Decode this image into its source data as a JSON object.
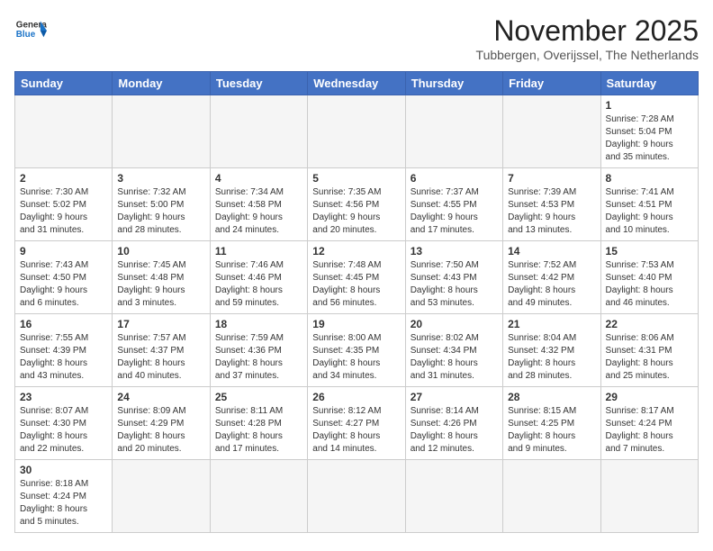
{
  "header": {
    "logo_general": "General",
    "logo_blue": "Blue",
    "month_year": "November 2025",
    "location": "Tubbergen, Overijssel, The Netherlands"
  },
  "weekdays": [
    "Sunday",
    "Monday",
    "Tuesday",
    "Wednesday",
    "Thursday",
    "Friday",
    "Saturday"
  ],
  "weeks": [
    [
      {
        "day": "",
        "info": ""
      },
      {
        "day": "",
        "info": ""
      },
      {
        "day": "",
        "info": ""
      },
      {
        "day": "",
        "info": ""
      },
      {
        "day": "",
        "info": ""
      },
      {
        "day": "",
        "info": ""
      },
      {
        "day": "1",
        "info": "Sunrise: 7:28 AM\nSunset: 5:04 PM\nDaylight: 9 hours\nand 35 minutes."
      }
    ],
    [
      {
        "day": "2",
        "info": "Sunrise: 7:30 AM\nSunset: 5:02 PM\nDaylight: 9 hours\nand 31 minutes."
      },
      {
        "day": "3",
        "info": "Sunrise: 7:32 AM\nSunset: 5:00 PM\nDaylight: 9 hours\nand 28 minutes."
      },
      {
        "day": "4",
        "info": "Sunrise: 7:34 AM\nSunset: 4:58 PM\nDaylight: 9 hours\nand 24 minutes."
      },
      {
        "day": "5",
        "info": "Sunrise: 7:35 AM\nSunset: 4:56 PM\nDaylight: 9 hours\nand 20 minutes."
      },
      {
        "day": "6",
        "info": "Sunrise: 7:37 AM\nSunset: 4:55 PM\nDaylight: 9 hours\nand 17 minutes."
      },
      {
        "day": "7",
        "info": "Sunrise: 7:39 AM\nSunset: 4:53 PM\nDaylight: 9 hours\nand 13 minutes."
      },
      {
        "day": "8",
        "info": "Sunrise: 7:41 AM\nSunset: 4:51 PM\nDaylight: 9 hours\nand 10 minutes."
      }
    ],
    [
      {
        "day": "9",
        "info": "Sunrise: 7:43 AM\nSunset: 4:50 PM\nDaylight: 9 hours\nand 6 minutes."
      },
      {
        "day": "10",
        "info": "Sunrise: 7:45 AM\nSunset: 4:48 PM\nDaylight: 9 hours\nand 3 minutes."
      },
      {
        "day": "11",
        "info": "Sunrise: 7:46 AM\nSunset: 4:46 PM\nDaylight: 8 hours\nand 59 minutes."
      },
      {
        "day": "12",
        "info": "Sunrise: 7:48 AM\nSunset: 4:45 PM\nDaylight: 8 hours\nand 56 minutes."
      },
      {
        "day": "13",
        "info": "Sunrise: 7:50 AM\nSunset: 4:43 PM\nDaylight: 8 hours\nand 53 minutes."
      },
      {
        "day": "14",
        "info": "Sunrise: 7:52 AM\nSunset: 4:42 PM\nDaylight: 8 hours\nand 49 minutes."
      },
      {
        "day": "15",
        "info": "Sunrise: 7:53 AM\nSunset: 4:40 PM\nDaylight: 8 hours\nand 46 minutes."
      }
    ],
    [
      {
        "day": "16",
        "info": "Sunrise: 7:55 AM\nSunset: 4:39 PM\nDaylight: 8 hours\nand 43 minutes."
      },
      {
        "day": "17",
        "info": "Sunrise: 7:57 AM\nSunset: 4:37 PM\nDaylight: 8 hours\nand 40 minutes."
      },
      {
        "day": "18",
        "info": "Sunrise: 7:59 AM\nSunset: 4:36 PM\nDaylight: 8 hours\nand 37 minutes."
      },
      {
        "day": "19",
        "info": "Sunrise: 8:00 AM\nSunset: 4:35 PM\nDaylight: 8 hours\nand 34 minutes."
      },
      {
        "day": "20",
        "info": "Sunrise: 8:02 AM\nSunset: 4:34 PM\nDaylight: 8 hours\nand 31 minutes."
      },
      {
        "day": "21",
        "info": "Sunrise: 8:04 AM\nSunset: 4:32 PM\nDaylight: 8 hours\nand 28 minutes."
      },
      {
        "day": "22",
        "info": "Sunrise: 8:06 AM\nSunset: 4:31 PM\nDaylight: 8 hours\nand 25 minutes."
      }
    ],
    [
      {
        "day": "23",
        "info": "Sunrise: 8:07 AM\nSunset: 4:30 PM\nDaylight: 8 hours\nand 22 minutes."
      },
      {
        "day": "24",
        "info": "Sunrise: 8:09 AM\nSunset: 4:29 PM\nDaylight: 8 hours\nand 20 minutes."
      },
      {
        "day": "25",
        "info": "Sunrise: 8:11 AM\nSunset: 4:28 PM\nDaylight: 8 hours\nand 17 minutes."
      },
      {
        "day": "26",
        "info": "Sunrise: 8:12 AM\nSunset: 4:27 PM\nDaylight: 8 hours\nand 14 minutes."
      },
      {
        "day": "27",
        "info": "Sunrise: 8:14 AM\nSunset: 4:26 PM\nDaylight: 8 hours\nand 12 minutes."
      },
      {
        "day": "28",
        "info": "Sunrise: 8:15 AM\nSunset: 4:25 PM\nDaylight: 8 hours\nand 9 minutes."
      },
      {
        "day": "29",
        "info": "Sunrise: 8:17 AM\nSunset: 4:24 PM\nDaylight: 8 hours\nand 7 minutes."
      }
    ],
    [
      {
        "day": "30",
        "info": "Sunrise: 8:18 AM\nSunset: 4:24 PM\nDaylight: 8 hours\nand 5 minutes."
      },
      {
        "day": "",
        "info": ""
      },
      {
        "day": "",
        "info": ""
      },
      {
        "day": "",
        "info": ""
      },
      {
        "day": "",
        "info": ""
      },
      {
        "day": "",
        "info": ""
      },
      {
        "day": "",
        "info": ""
      }
    ]
  ]
}
